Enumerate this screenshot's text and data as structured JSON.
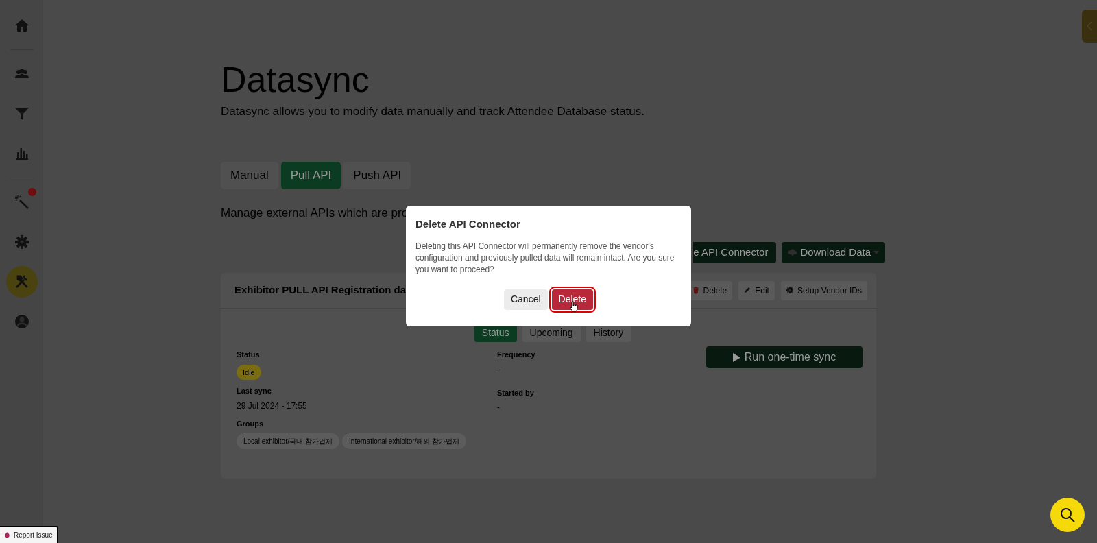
{
  "sidebar": {
    "items": [
      {
        "kind": "home",
        "selected": false,
        "notification": false,
        "divider_after": true
      },
      {
        "kind": "people",
        "selected": false,
        "notification": false,
        "divider_after": false
      },
      {
        "kind": "filter",
        "selected": false,
        "notification": false,
        "divider_after": false
      },
      {
        "kind": "chart",
        "selected": false,
        "notification": false,
        "divider_after": true
      },
      {
        "kind": "wand",
        "selected": false,
        "notification": true,
        "divider_after": false
      },
      {
        "kind": "gear",
        "selected": false,
        "notification": false,
        "divider_after": false
      },
      {
        "kind": "tools",
        "selected": true,
        "notification": false,
        "divider_after": false
      },
      {
        "kind": "account",
        "selected": false,
        "notification": false,
        "divider_after": false
      }
    ]
  },
  "page": {
    "title": "Datasync",
    "subtitle": "Datasync allows you to modify data manually and track Attendee Database status.",
    "tabs": [
      {
        "label": "Manual",
        "selected": false
      },
      {
        "label": "Pull API",
        "selected": true
      },
      {
        "label": "Push API",
        "selected": false
      }
    ],
    "description": "Manage external APIs which are pro",
    "actions": [
      {
        "label": "e API Connector",
        "kind": "partial"
      },
      {
        "label": "Download Data",
        "kind": "dropdown"
      }
    ]
  },
  "card": {
    "title": "Exhibitor PULL API Registration da",
    "actions": [
      {
        "label": "Delete",
        "kind": "delete"
      },
      {
        "label": "Edit",
        "kind": "edit"
      },
      {
        "label": "Setup Vendor IDs",
        "kind": "setup"
      }
    ],
    "tabs": [
      {
        "label": "Status",
        "selected": true
      },
      {
        "label": "Upcoming",
        "selected": false
      },
      {
        "label": "History",
        "selected": false
      }
    ],
    "status": {
      "label": "Status",
      "value": "Idle"
    },
    "last_sync": {
      "label": "Last sync",
      "value": "29 Jul 2024 - 17:55"
    },
    "groups": {
      "label": "Groups",
      "tags": [
        "Local exhibitor/국내 참가업체",
        "International exhibitor/해외 참가업체"
      ]
    },
    "frequency": {
      "label": "Frequency",
      "value": "-"
    },
    "started_by": {
      "label": "Started by",
      "value": "-"
    },
    "run_button": "Run one-time sync"
  },
  "modal": {
    "title": "Delete API Connector",
    "body": "Deleting this API Connector will permanently remove the vendor's configuration and previously pulled data will remain intact. Are you sure you want to proceed?",
    "buttons": [
      {
        "label": "Cancel",
        "kind": "secondary",
        "highlighted": false
      },
      {
        "label": "Delete",
        "kind": "danger",
        "highlighted": true
      }
    ]
  },
  "report_issue": "Report Issue"
}
